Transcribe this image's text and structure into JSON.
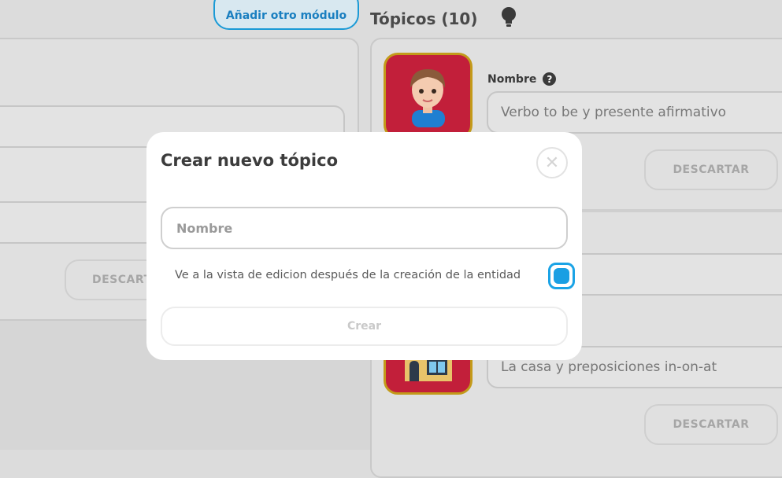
{
  "background": {
    "add_module_label": "Añadir otro módulo",
    "topics_title": "Tópicos (10)",
    "left_discard_label": "DESCART",
    "topic1": {
      "name_label": "Nombre",
      "name_value": "Verbo to be y presente afirmativo",
      "discard_label": "DESCARTAR"
    },
    "topic2": {
      "name_value": "La casa y preposiciones in-on-at",
      "discard_label": "DESCARTAR"
    }
  },
  "modal": {
    "title": "Crear nuevo tópico",
    "name_placeholder": "Nombre",
    "checkbox_label": "Ve a la vista de edicion después de la creación de la entidad",
    "checkbox_checked": true,
    "create_label": "Crear"
  },
  "colors": {
    "accent": "#1a9fe3",
    "tile": "#c21f3a",
    "tile_border": "#c39a1a"
  }
}
